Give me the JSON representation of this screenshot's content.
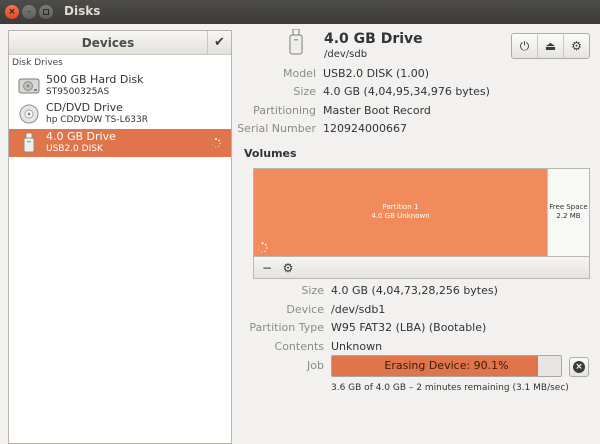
{
  "window": {
    "title": "Disks",
    "close_glyph": "×",
    "min_glyph": "–"
  },
  "sidebar": {
    "header": "Devices",
    "check_glyph": "✔",
    "section_label": "Disk Drives",
    "drives": [
      {
        "name": "500 GB Hard Disk",
        "sub": "ST9500325AS",
        "icon": "hard-disk-icon"
      },
      {
        "name": "CD/DVD Drive",
        "sub": "hp      CDDVDW TS-L633R",
        "icon": "optical-drive-icon"
      },
      {
        "name": "4.0 GB Drive",
        "sub": "USB2.0 DISK",
        "icon": "usb-drive-icon",
        "selected": true
      }
    ]
  },
  "drive": {
    "title": "4.0 GB Drive",
    "device": "/dev/sdb",
    "props": [
      {
        "label": "Model",
        "value": "USB2.0 DISK (1.00)"
      },
      {
        "label": "Size",
        "value": "4.0 GB (4,04,95,34,976 bytes)"
      },
      {
        "label": "Partitioning",
        "value": "Master Boot Record"
      },
      {
        "label": "Serial Number",
        "value": "120924000667"
      }
    ],
    "actions": {
      "power": "⏻",
      "eject": "⏏",
      "settings": "⚙"
    }
  },
  "volumes": {
    "heading": "Volumes",
    "partition": {
      "name": "Partition 1",
      "size": "4.0 GB Unknown"
    },
    "free": {
      "name": "Free Space",
      "size": "2.2 MB"
    },
    "tools": {
      "remove": "−",
      "settings": "⚙"
    },
    "props": [
      {
        "label": "Size",
        "value": "4.0 GB (4,04,73,28,256 bytes)"
      },
      {
        "label": "Device",
        "value": "/dev/sdb1"
      },
      {
        "label": "Partition Type",
        "value": "W95 FAT32 (LBA) (Bootable)"
      },
      {
        "label": "Contents",
        "value": "Unknown"
      },
      {
        "label": "Job",
        "value": ""
      }
    ],
    "job": {
      "text": "Erasing Device: 90.1%",
      "progress": 0.901,
      "remaining": "3.6 GB of 4.0 GB – 2 minutes remaining (3.1 MB/sec)",
      "cancel_glyph": "×"
    }
  },
  "colors": {
    "accent": "#e0744a",
    "partition": "#f28b5c"
  }
}
